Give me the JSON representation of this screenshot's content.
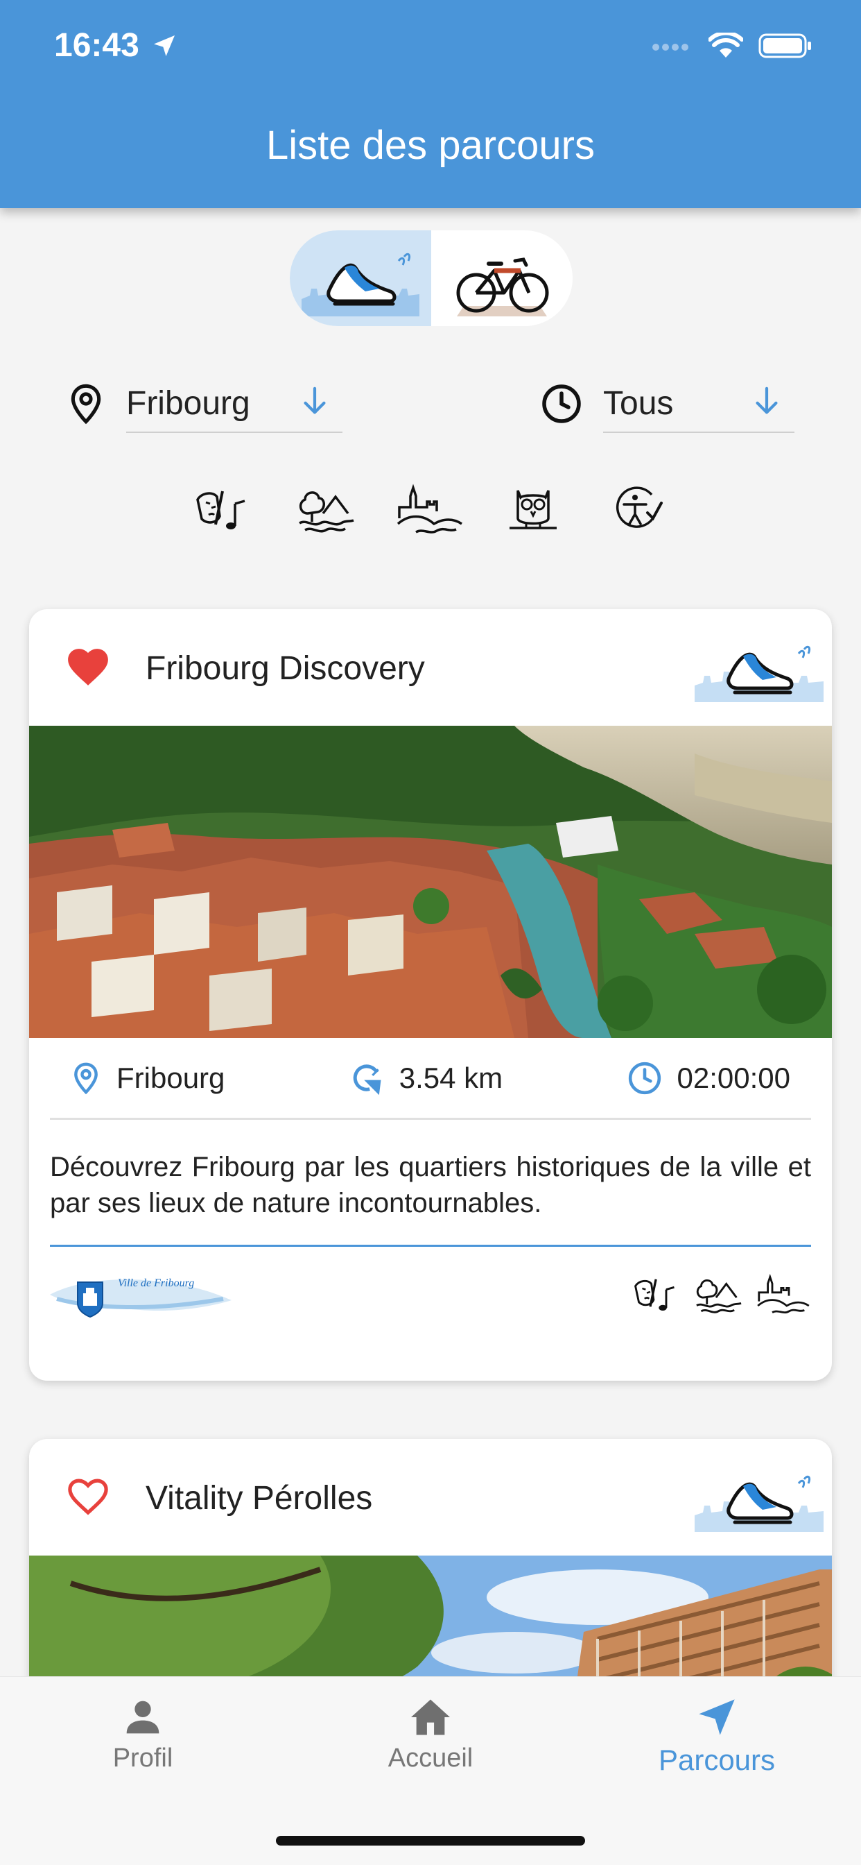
{
  "status": {
    "time": "16:43"
  },
  "header": {
    "title": "Liste des parcours"
  },
  "modes": [
    {
      "name": "walk",
      "icon": "walking-shoe-icon",
      "active": true
    },
    {
      "name": "bike",
      "icon": "bicycle-icon",
      "active": false
    }
  ],
  "filters": {
    "location": {
      "value": "Fribourg"
    },
    "duration": {
      "value": "Tous"
    }
  },
  "categories": [
    "culture-icon",
    "nature-icon",
    "heritage-icon",
    "owl-icon",
    "accessibility-icon"
  ],
  "routes": [
    {
      "title": "Fribourg Discovery",
      "favorite": true,
      "location": "Fribourg",
      "distance": "3.54 km",
      "duration": "02:00:00",
      "description": "Découvrez Fribourg par les quartiers historiques de la ville et par ses lieux de nature incontournables.",
      "partner_logo": "Ville de Fribourg"
    },
    {
      "title": "Vitality Pérolles",
      "favorite": false
    }
  ],
  "tabbar": {
    "profile": "Profil",
    "home": "Accueil",
    "routes": "Parcours"
  },
  "colors": {
    "accent": "#4a95d9",
    "favorite": "#e8413c"
  }
}
